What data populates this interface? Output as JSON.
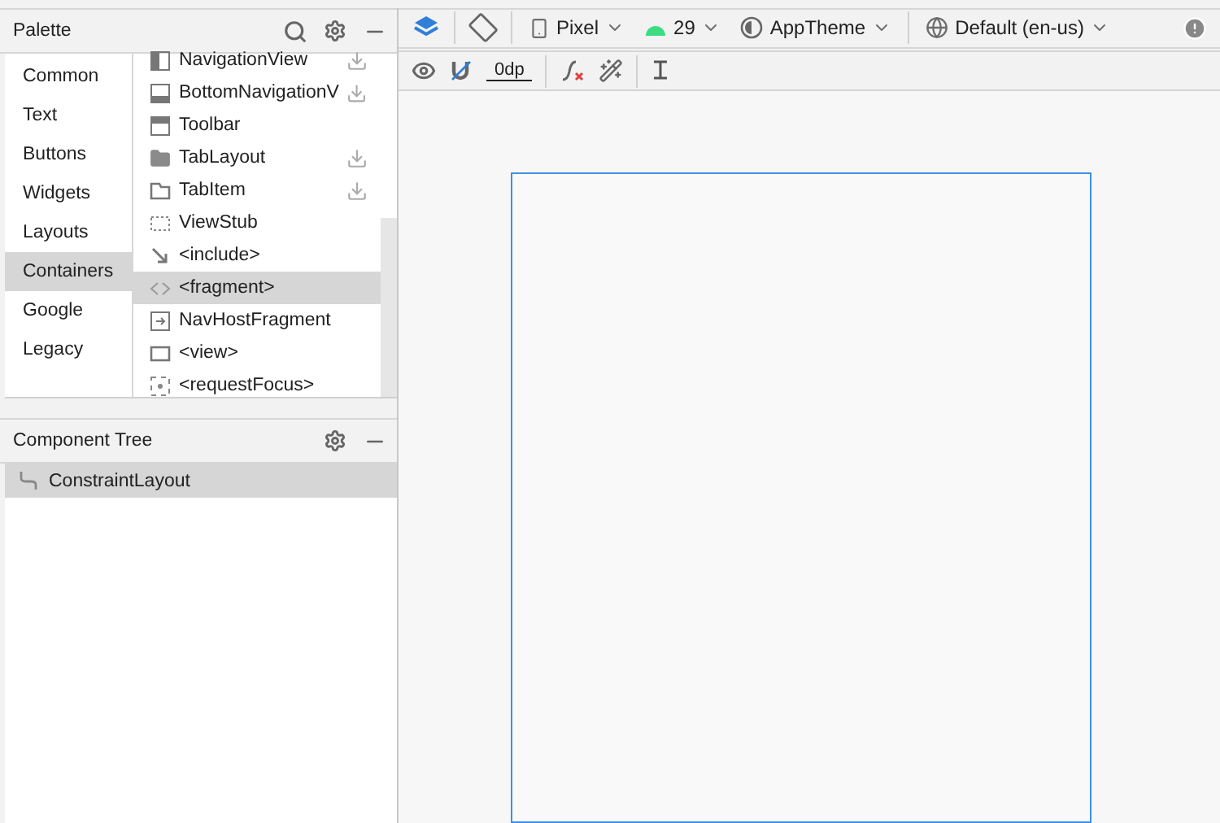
{
  "palette": {
    "title": "Palette",
    "categories": [
      {
        "label": "Common",
        "selected": false
      },
      {
        "label": "Text",
        "selected": false
      },
      {
        "label": "Buttons",
        "selected": false
      },
      {
        "label": "Widgets",
        "selected": false
      },
      {
        "label": "Layouts",
        "selected": false
      },
      {
        "label": "Containers",
        "selected": true
      },
      {
        "label": "Google",
        "selected": false
      },
      {
        "label": "Legacy",
        "selected": false
      }
    ],
    "items": [
      {
        "label": "NavigationView",
        "kind": "nav",
        "downloadable": true,
        "selected": false
      },
      {
        "label": "BottomNavigationV",
        "kind": "bottomnav",
        "downloadable": true,
        "selected": false
      },
      {
        "label": "Toolbar",
        "kind": "toolbar",
        "downloadable": false,
        "selected": false
      },
      {
        "label": "TabLayout",
        "kind": "folder",
        "downloadable": true,
        "selected": false
      },
      {
        "label": "TabItem",
        "kind": "tab",
        "downloadable": true,
        "selected": false
      },
      {
        "label": "ViewStub",
        "kind": "stub",
        "downloadable": false,
        "selected": false
      },
      {
        "label": "<include>",
        "kind": "include",
        "downloadable": false,
        "selected": false
      },
      {
        "label": "<fragment>",
        "kind": "code",
        "downloadable": false,
        "selected": true
      },
      {
        "label": "NavHostFragment",
        "kind": "host",
        "downloadable": false,
        "selected": false
      },
      {
        "label": "<view>",
        "kind": "view",
        "downloadable": false,
        "selected": false
      },
      {
        "label": "<requestFocus>",
        "kind": "focus",
        "downloadable": false,
        "selected": false
      }
    ]
  },
  "component_tree": {
    "title": "Component Tree",
    "nodes": [
      {
        "label": "ConstraintLayout",
        "selected": true
      }
    ]
  },
  "toolbar": {
    "device": "Pixel",
    "api": "29",
    "theme": "AppTheme",
    "locale": "Default (en-us)",
    "margin": "0dp"
  }
}
